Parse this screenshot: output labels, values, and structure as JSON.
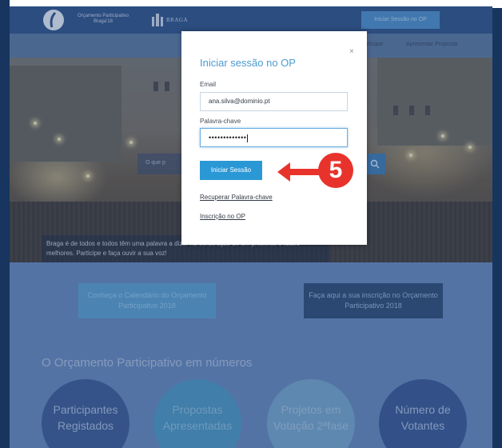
{
  "header": {
    "logo_title": "Orçamento Participativo Braga'18",
    "city_name": "BRAGA",
    "login_button": "Iniciar Sessão no OP"
  },
  "nav": {
    "items": [
      {
        "label": "Participar"
      },
      {
        "label": "Apresentar Proposta"
      }
    ]
  },
  "hero": {
    "search_placeholder": "O que p",
    "tagline": "Braga é de todos e todos têm uma palavra a dizer na construção de um presente e futuro melhores. Participe e faça ouvir a sua voz!"
  },
  "cta": {
    "calendar": "Conheça o Calendário do Orçamento Participativo 2018",
    "register": "Faça aqui a sua inscrição no Orçamento Participativo 2018"
  },
  "numbers": {
    "title": "O Orçamento Participativo em números",
    "stats": [
      {
        "label": "Participantes Registados"
      },
      {
        "label": "Propostas Apresentadas"
      },
      {
        "label": "Projetos em Votação 2ªfase"
      },
      {
        "label": "Número de Votantes"
      }
    ]
  },
  "modal": {
    "title": "Iniciar sessão no OP",
    "close": "×",
    "email_label": "Email",
    "email_value": "ana.silva@dominio.pt",
    "password_label": "Palavra-chave",
    "password_value": "•••••••••••••",
    "submit_label": "Iniciar Sessão",
    "recover_link": "Recuperar Palavra-chave",
    "register_link": "Inscrição no OP"
  },
  "annotation": {
    "step": "5",
    "color": "#e8332c"
  },
  "colors": {
    "header_bg": "#1f4478",
    "accent_blue": "#2b98d6",
    "modal_title": "#4a9bd0"
  }
}
